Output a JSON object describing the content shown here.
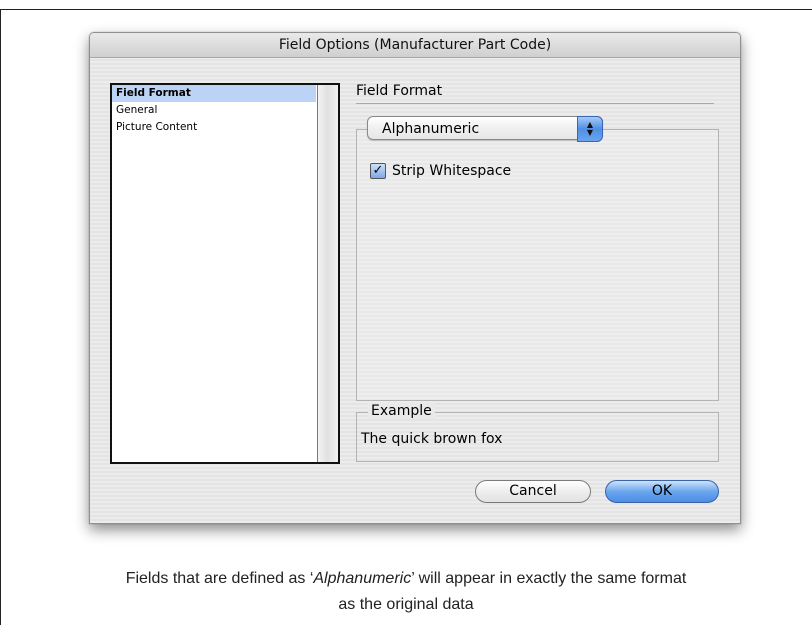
{
  "dialog": {
    "title": "Field Options (Manufacturer Part Code)",
    "list_items": [
      {
        "label": "Field Format",
        "selected": true
      },
      {
        "label": "General",
        "selected": false
      },
      {
        "label": "Picture Content",
        "selected": false
      }
    ],
    "section_title": "Field Format",
    "format_popup": {
      "value": "Alphanumeric",
      "icon": "popup-arrows-icon"
    },
    "strip_whitespace": {
      "label": "Strip Whitespace",
      "checked": true
    },
    "example": {
      "legend": "Example",
      "text": "The quick brown fox"
    },
    "buttons": {
      "cancel": "Cancel",
      "ok": "OK"
    },
    "colors": {
      "selection": "#bcd3f5",
      "accent": "#4b8de6"
    }
  },
  "caption": {
    "line1_before": "Fields that are defined as ‘",
    "line1_em": "Alphanumeric",
    "line1_after": "’ will appear in exactly the same format",
    "line2": "as the original data"
  }
}
